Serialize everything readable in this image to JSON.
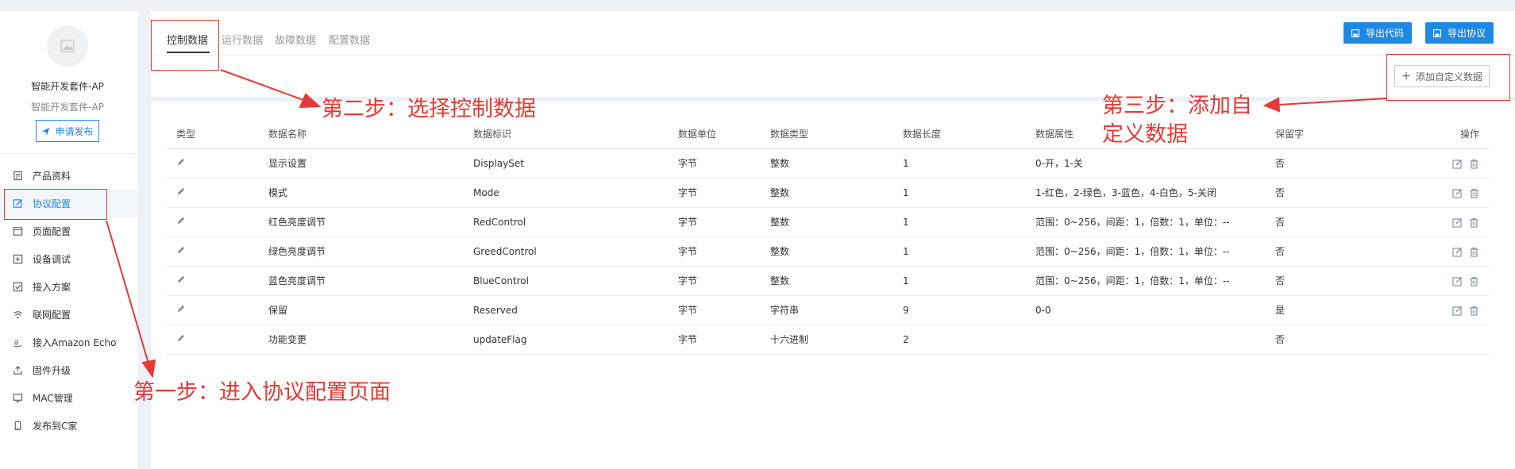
{
  "sidebar": {
    "app_name": "智能开发套件-AP",
    "app_subtitle": "智能开发套件-AP",
    "apply_button": "申请发布",
    "items": [
      {
        "label": "产品资料",
        "icon": "document-icon"
      },
      {
        "label": "协议配置",
        "icon": "edit-icon",
        "active": true
      },
      {
        "label": "页面配置",
        "icon": "page-icon"
      },
      {
        "label": "设备调试",
        "icon": "debug-icon"
      },
      {
        "label": "接入方案",
        "icon": "checkbox-icon"
      },
      {
        "label": "联网配置",
        "icon": "wifi-icon"
      },
      {
        "label": "接入Amazon Echo",
        "icon": "amazon-icon"
      },
      {
        "label": "固件升级",
        "icon": "upload-icon"
      },
      {
        "label": "MAC管理",
        "icon": "monitor-icon"
      },
      {
        "label": "发布到C家",
        "icon": "phone-icon"
      }
    ]
  },
  "tabs": [
    "控制数据",
    "运行数据",
    "故障数据",
    "配置数据"
  ],
  "actions": {
    "export_code": "导出代码",
    "export_protocol": "导出协议",
    "add_custom": "添加自定义数据"
  },
  "table": {
    "headers": [
      "类型",
      "数据名称",
      "数据标识",
      "数据单位",
      "数据类型",
      "数据长度",
      "数据属性",
      "保留字",
      "操作"
    ],
    "rows": [
      [
        "显示设置",
        "DisplaySet",
        "字节",
        "整数",
        "1",
        "0-开，1-关",
        "否"
      ],
      [
        "模式",
        "Mode",
        "字节",
        "整数",
        "1",
        "1-红色，2-绿色，3-蓝色，4-白色，5-关闭",
        "否"
      ],
      [
        "红色亮度调节",
        "RedControl",
        "字节",
        "整数",
        "1",
        "范围：0~256，间距：1，倍数：1，单位：--",
        "否"
      ],
      [
        "绿色亮度调节",
        "GreedControl",
        "字节",
        "整数",
        "1",
        "范围：0~256，间距：1，倍数：1，单位：--",
        "否"
      ],
      [
        "蓝色亮度调节",
        "BlueControl",
        "字节",
        "整数",
        "1",
        "范围：0~256，间距：1，倍数：1，单位：--",
        "否"
      ],
      [
        "保留",
        "Reserved",
        "字节",
        "字符串",
        "9",
        "0-0",
        "是"
      ],
      [
        "功能变更",
        "updateFlag",
        "字节",
        "十六进制",
        "2",
        "",
        "否"
      ]
    ]
  },
  "annotations": {
    "step1": "第一步：进入协议配置页面",
    "step2": "第二步：选择控制数据",
    "step3_line1": "第三步：添加自",
    "step3_line2": "定义数据"
  },
  "colors": {
    "accent": "#1e88e5",
    "annotation": "#e53935"
  }
}
